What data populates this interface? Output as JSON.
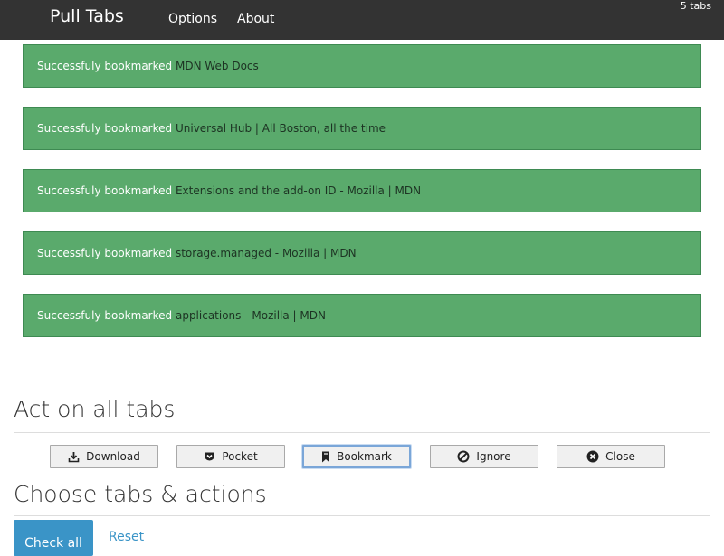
{
  "navbar": {
    "brand": "Pull Tabs",
    "links": [
      "Options",
      "About"
    ],
    "tab_count": "5 tabs"
  },
  "alerts": [
    {
      "status": "Successfuly bookmarked",
      "title": "MDN Web Docs"
    },
    {
      "status": "Successfuly bookmarked",
      "title": "Universal Hub | All Boston, all the time"
    },
    {
      "status": "Successfuly bookmarked",
      "title": "Extensions and the add-on ID - Mozilla | MDN"
    },
    {
      "status": "Successfuly bookmarked",
      "title": "storage.managed - Mozilla | MDN"
    },
    {
      "status": "Successfuly bookmarked",
      "title": "applications - Mozilla | MDN"
    }
  ],
  "act_section": {
    "heading": "Act on all tabs",
    "buttons": [
      {
        "label": "Download",
        "icon": "download-icon"
      },
      {
        "label": "Pocket",
        "icon": "pocket-icon"
      },
      {
        "label": "Bookmark",
        "icon": "bookmark-icon"
      },
      {
        "label": "Ignore",
        "icon": "ignore-icon"
      },
      {
        "label": "Close",
        "icon": "close-icon"
      }
    ]
  },
  "choose_section": {
    "heading": "Choose tabs & actions",
    "check_all": "Check all",
    "reset": "Reset"
  },
  "colors": {
    "navbar": "#333333",
    "alert_success": "#5aaa6c",
    "primary": "#3a94c7"
  }
}
